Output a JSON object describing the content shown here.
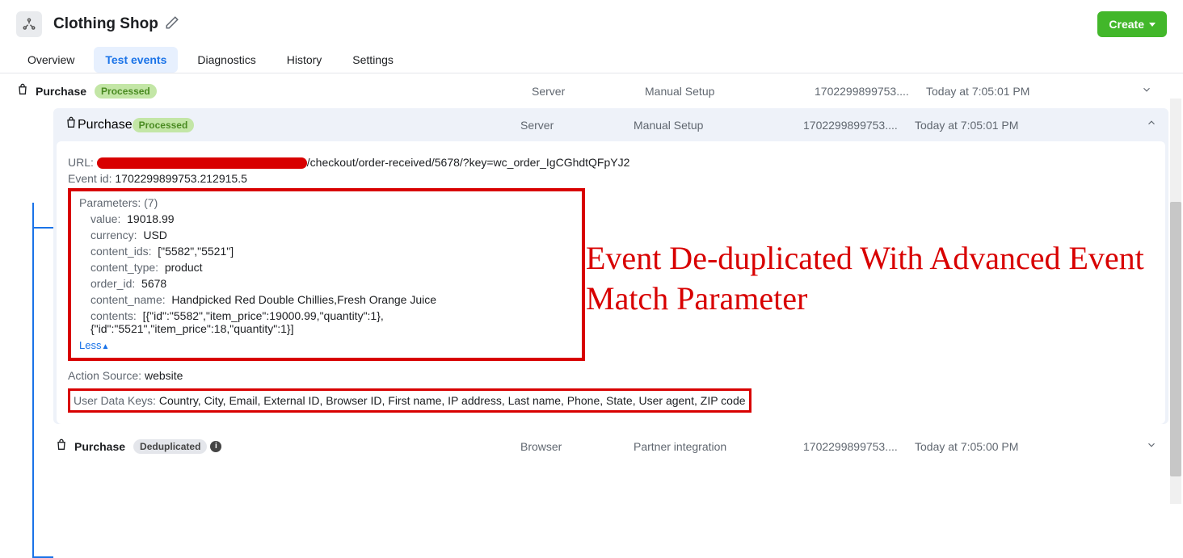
{
  "header": {
    "title": "Clothing Shop",
    "create_label": "Create"
  },
  "tabs": {
    "overview": "Overview",
    "test_events": "Test events",
    "diagnostics": "Diagnostics",
    "history": "History",
    "settings": "Settings"
  },
  "events": [
    {
      "name": "Purchase",
      "status": "Processed",
      "received_from": "Server",
      "setup_method": "Manual Setup",
      "event_id": "1702299899753....",
      "time": "Today at 7:05:01 PM"
    },
    {
      "name": "Purchase",
      "status": "Processed",
      "received_from": "Server",
      "setup_method": "Manual Setup",
      "event_id": "1702299899753....",
      "time": "Today at 7:05:01 PM"
    },
    {
      "name": "Purchase",
      "status": "Deduplicated",
      "received_from": "Browser",
      "setup_method": "Partner integration",
      "event_id": "1702299899753....",
      "time": "Today at 7:05:00 PM"
    }
  ],
  "detail": {
    "url_label": "URL:",
    "url_suffix": "/checkout/order-received/5678/?key=wc_order_IgCGhdtQFpYJ2",
    "event_id_label": "Event id:",
    "event_id_value": "1702299899753.212915.5",
    "params_title": "Parameters: (7)",
    "params": {
      "value_l": "value:",
      "value_v": "19018.99",
      "currency_l": "currency:",
      "currency_v": "USD",
      "content_ids_l": "content_ids:",
      "content_ids_v": "[\"5582\",\"5521\"]",
      "content_type_l": "content_type:",
      "content_type_v": "product",
      "order_id_l": "order_id:",
      "order_id_v": "5678",
      "content_name_l": "content_name:",
      "content_name_v": "Handpicked Red Double Chillies,Fresh Orange Juice",
      "contents_l": "contents:",
      "contents_v": "[{\"id\":\"5582\",\"item_price\":19000.99,\"quantity\":1},{\"id\":\"5521\",\"item_price\":18,\"quantity\":1}]"
    },
    "less_label": "Less",
    "action_source_label": "Action Source:",
    "action_source_value": "website",
    "udk_label": "User Data Keys:",
    "udk_value": "Country, City, Email, External ID, Browser ID, First name, IP address, Last name, Phone, State, User agent, ZIP code"
  },
  "annotation": "Event De-duplicated With Advanced Event Match Parameter"
}
